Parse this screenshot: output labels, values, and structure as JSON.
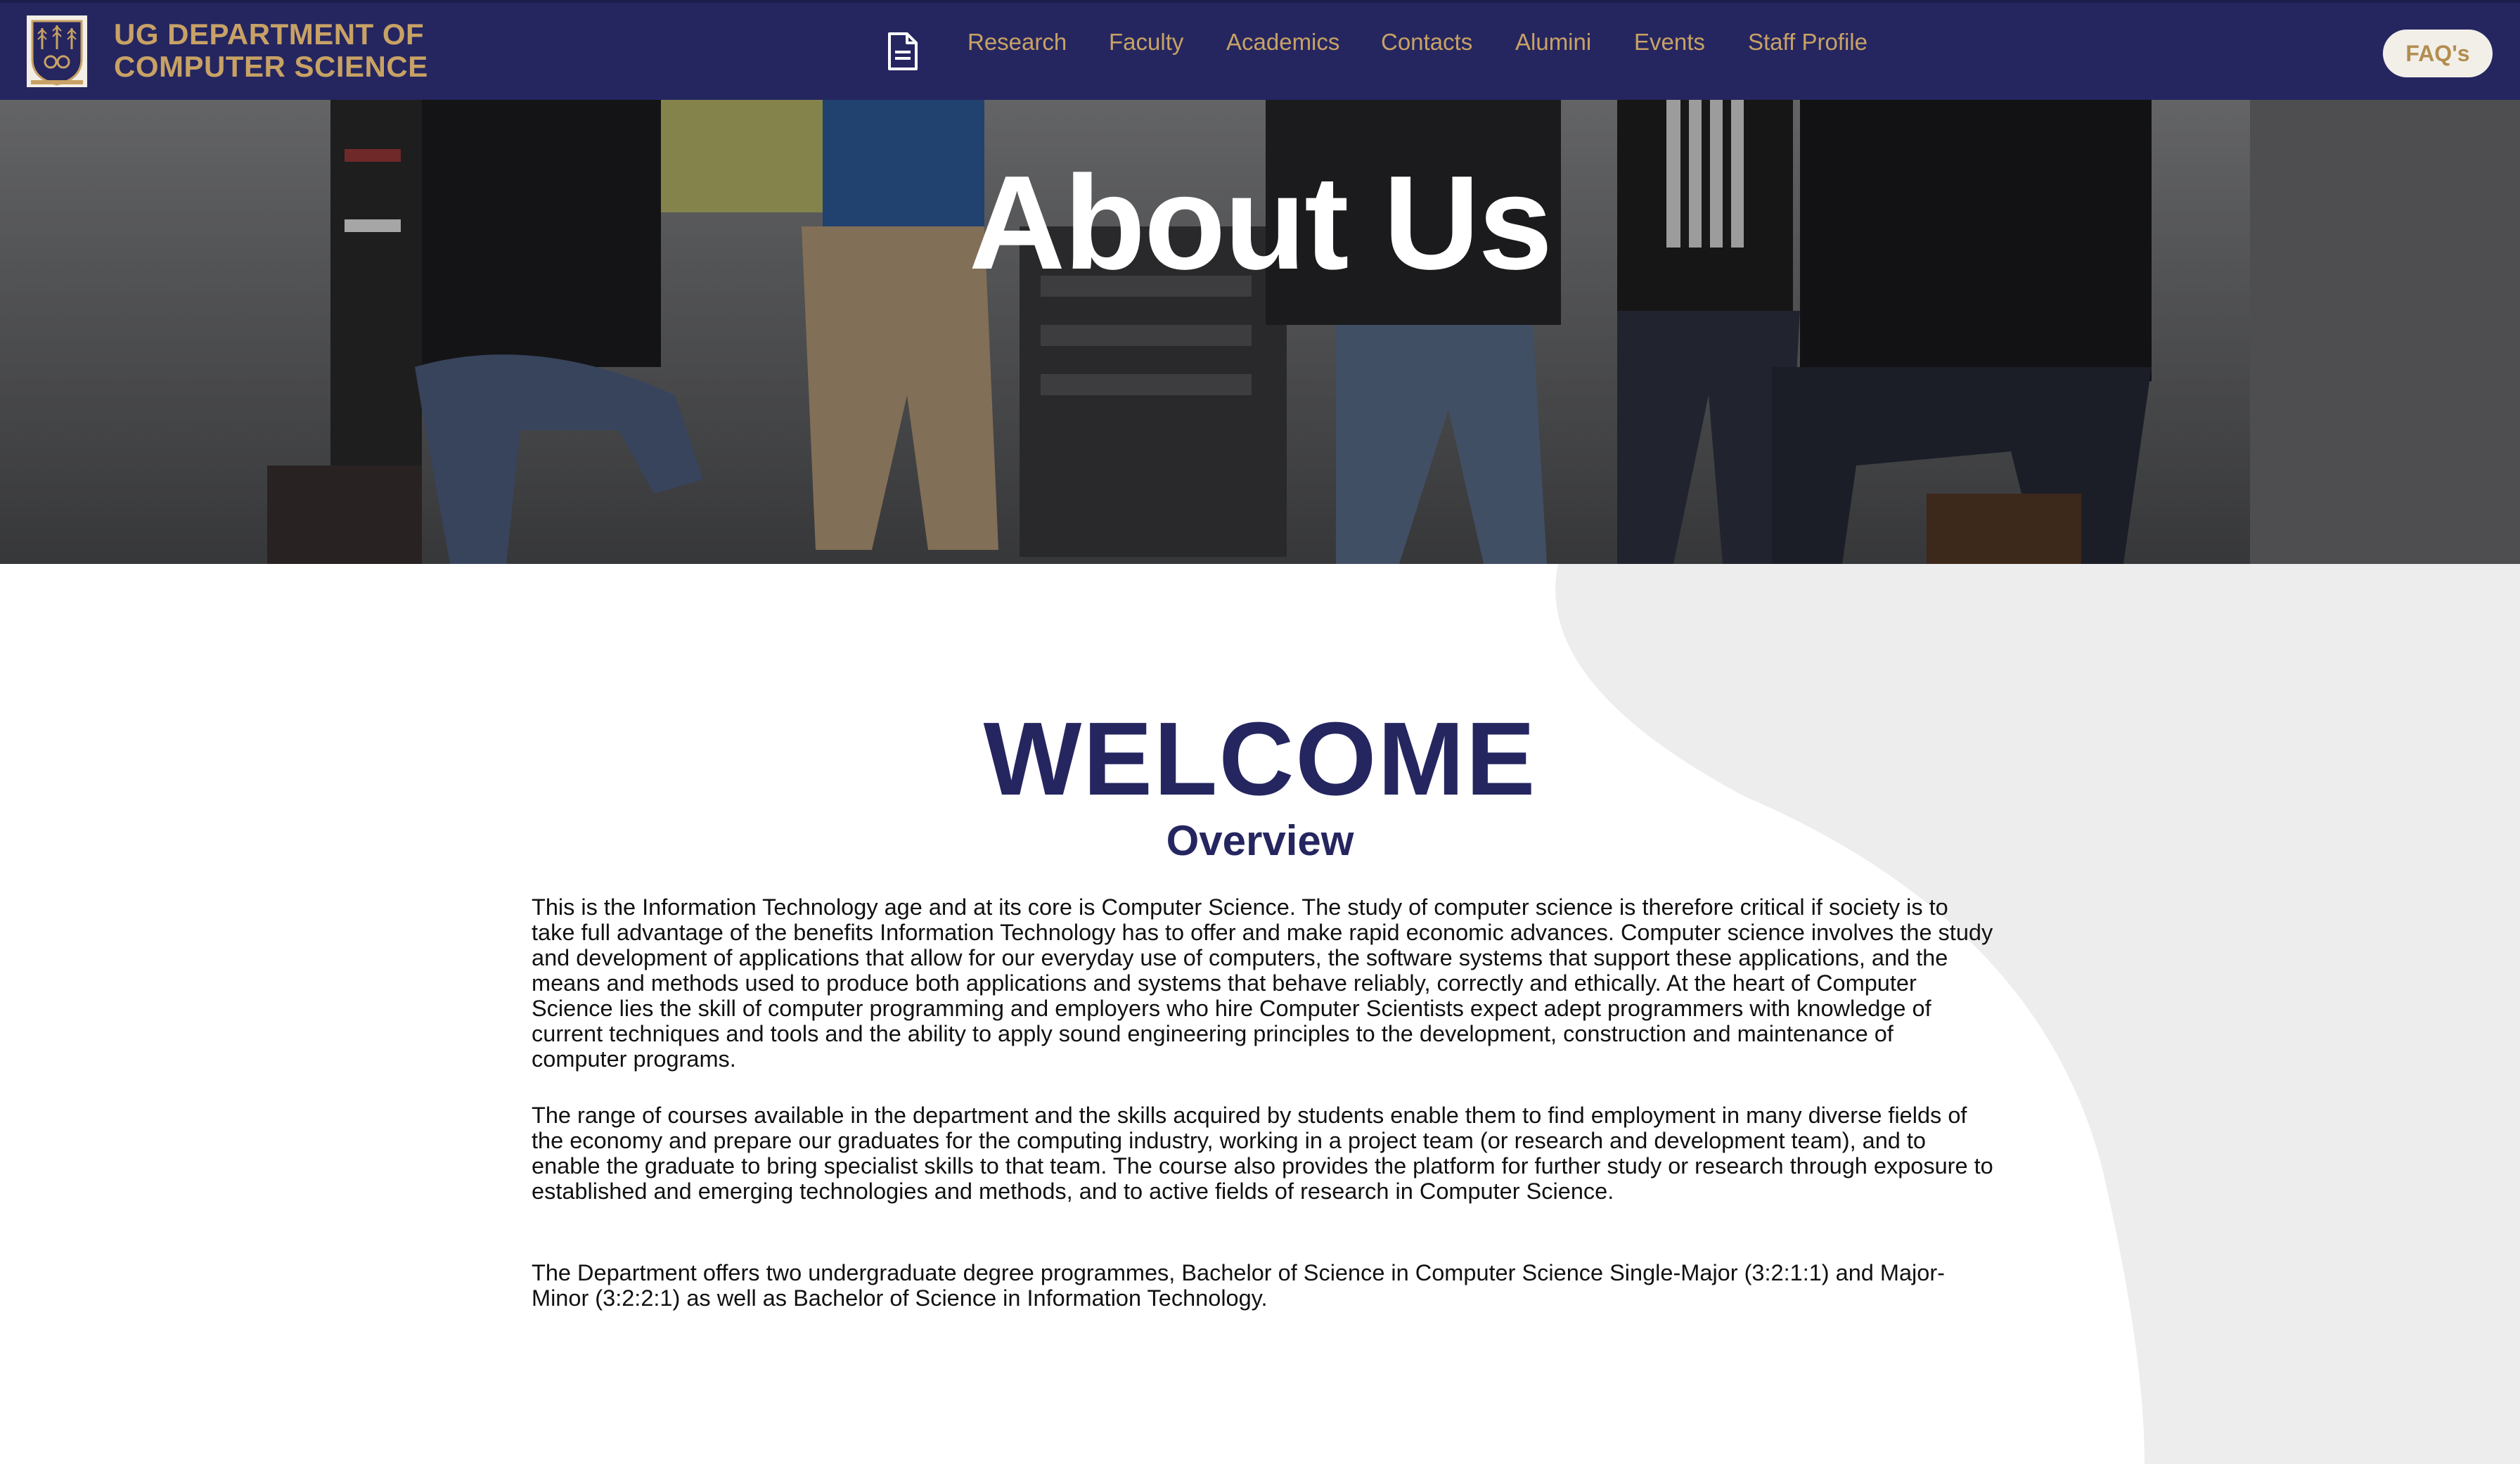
{
  "header": {
    "brand_line1": "UG DEPARTMENT OF",
    "brand_line2": "COMPUTER SCIENCE",
    "logo_icon": "university-crest-icon",
    "doc_icon": "document-icon",
    "nav": [
      {
        "label": "Research"
      },
      {
        "label": "Faculty"
      },
      {
        "label": "Academics"
      },
      {
        "label": "Contacts"
      },
      {
        "label": "Alumini"
      },
      {
        "label": "Events"
      },
      {
        "label": "Staff Profile"
      }
    ],
    "faq_label": "FAQ's"
  },
  "hero": {
    "title": "About Us"
  },
  "main": {
    "heading": "WELCOME",
    "subheading": "Overview",
    "paragraphs": [
      "This is the Information Technology age and at its core is Computer Science. The study of computer science is therefore critical if society is to take full advantage of the benefits Information Technology has to offer and make rapid economic advances. Computer science involves the study and development of applications that allow for our everyday use of computers, the software systems that support these applications, and the means and methods used to produce both applications and systems that behave reliably, correctly and ethically. At the heart of Computer Science lies the skill of computer programming and employers who hire Computer Scientists expect adept programmers with knowledge of current techniques and tools and the ability to apply sound engineering principles to the development, construction and maintenance of computer programs.",
      "The range of courses available in the department and the skills acquired by students enable them to find employment in many diverse fields of the economy and prepare our graduates for the computing industry, working in a project team (or research and development team), and to enable the graduate to bring specialist skills to that team. The course also provides the platform for further study or research through exposure to established and emerging technologies and methods, and to active fields of research in Computer Science.",
      "The Department offers two undergraduate degree programmes, Bachelor of Science in Computer Science Single-Major (3:2:1:1) and Major-Minor (3:2:2:1) as well as Bachelor of Science in Information Technology."
    ]
  },
  "colors": {
    "navy": "#252660",
    "gold": "#c8a265",
    "wave_grey": "#ededed"
  }
}
